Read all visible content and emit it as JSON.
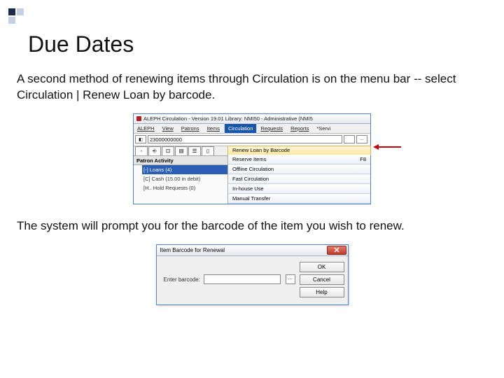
{
  "slide": {
    "title": "Due Dates",
    "paragraph1": "A second method of renewing items through Circulation is on the menu bar -- select Circulation | Renew Loan by barcode.",
    "paragraph2": "The system will prompt you for the barcode of the item you wish to renew."
  },
  "screenshot1": {
    "window_title": "ALEPH Circulation - Version 19.01  Library: NMI50 - Administrative (NMI5",
    "menubar": [
      "ALEPH",
      "View",
      "Patrons",
      "Items",
      "Circulation",
      "Requests",
      "Reports",
      "*Servi"
    ],
    "active_menu_index": 4,
    "top_input_value": "23000000000",
    "left_panel": {
      "header": "Patron Activity",
      "items": [
        "[-] Loans (4)",
        "[C] Cash (15.00 in debit)",
        "[H.. Hold Requests (0)"
      ],
      "selected_index": 0
    },
    "dropdown": [
      {
        "label": "Renew Loan by Barcode",
        "shortcut": ""
      },
      {
        "label": "Reserve Items",
        "shortcut": "F8"
      },
      {
        "label": "Offline Circulation",
        "shortcut": ""
      },
      {
        "label": "Fast Circulation",
        "shortcut": ""
      },
      {
        "label": "In-house Use",
        "shortcut": ""
      },
      {
        "label": "Manual Transfer",
        "shortcut": ""
      }
    ],
    "highlighted_dropdown_index": 0
  },
  "screenshot2": {
    "title": "Item Barcode for Renewal",
    "label": "Enter barcode:",
    "buttons": [
      "OK",
      "Cancel",
      "Help"
    ]
  }
}
